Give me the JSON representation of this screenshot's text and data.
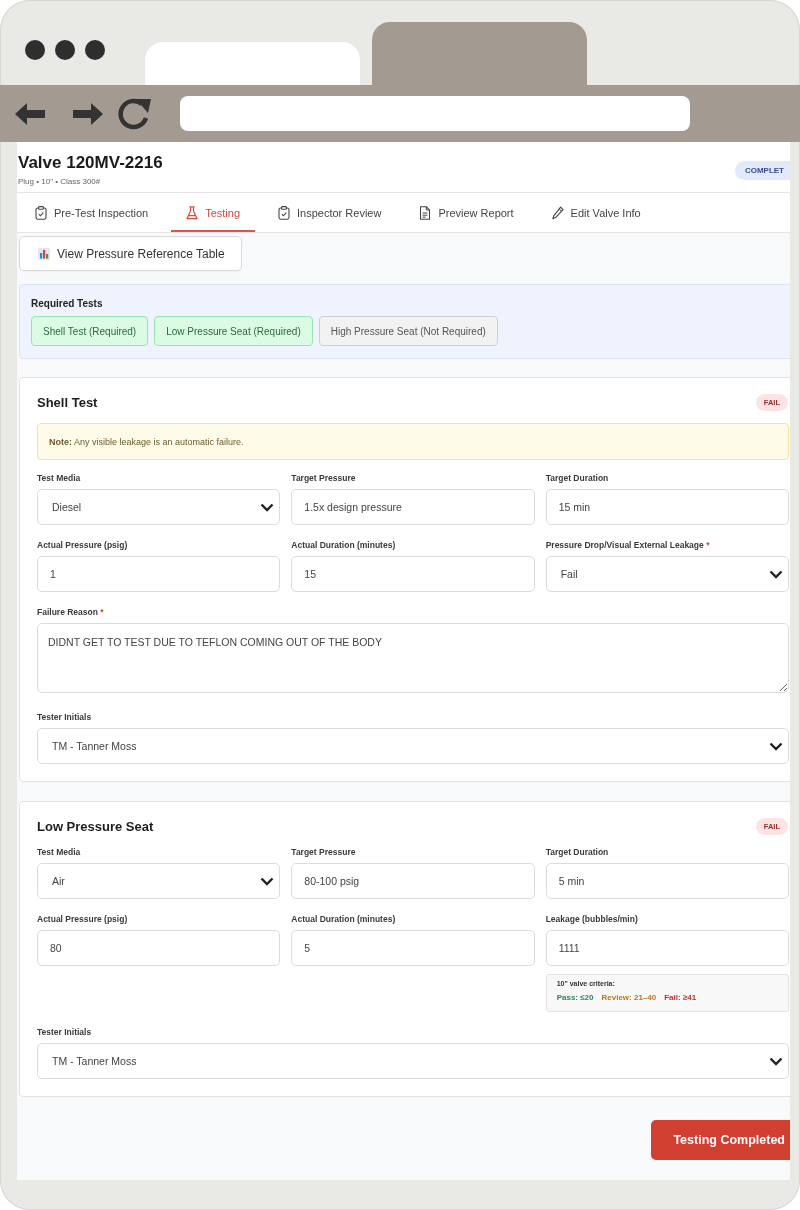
{
  "browser": {
    "tabs": [
      {
        "selected": true
      },
      {
        "selected": false
      }
    ]
  },
  "valve": {
    "title": "Valve 120MV-2216",
    "subtitle": "Plug • 10\" • Class 300#",
    "status": {
      "label": "COMPLET",
      "kind": "complete"
    }
  },
  "tabs": [
    {
      "label": "Pre-Test Inspection",
      "selected": false
    },
    {
      "label": "Testing",
      "selected": true
    },
    {
      "label": "Inspector Review",
      "selected": false
    },
    {
      "label": "Preview Report",
      "selected": false
    },
    {
      "label": "Edit Valve Info",
      "selected": false
    }
  ],
  "reference_button": {
    "label": "View Pressure Reference Table"
  },
  "required_tests": {
    "title": "Required Tests",
    "items": [
      {
        "label": "Shell Test (Required)",
        "required": true
      },
      {
        "label": "Low Pressure Seat (Required)",
        "required": true
      },
      {
        "label": "High Pressure Seat (Not Required)",
        "required": false
      }
    ]
  },
  "tests": [
    {
      "title": "Shell Test",
      "result": {
        "label": "FAIL",
        "kind": "fail"
      },
      "note": "**Note:** Any visible leakage is an automatic failure.",
      "rows": [
        [
          {
            "label": "Test Media",
            "kind": "select",
            "value": "Diesel"
          },
          {
            "label": "Target Pressure",
            "kind": "text",
            "value": "1.5x design pressure"
          },
          {
            "label": "Target Duration",
            "kind": "text",
            "value": "15 min"
          }
        ],
        [
          {
            "label": "Actual Pressure (psig)",
            "kind": "text",
            "value": "1"
          },
          {
            "label": "Actual Duration (minutes)",
            "kind": "text",
            "value": "15"
          },
          {
            "label": "Pressure Drop/Visual External Leakage",
            "required_mark": "*",
            "kind": "select",
            "value": "Fail"
          }
        ],
        [
          {
            "label": "Failure Reason",
            "required_mark": "*",
            "kind": "textarea",
            "value": "DIDNT GET TO TEST DUE TO TEFLON COMING OUT OF THE BODY"
          }
        ],
        [
          {
            "label": "Tester Initials",
            "kind": "select",
            "value": "TM - Tanner Moss"
          }
        ]
      ]
    },
    {
      "title": "Low Pressure Seat",
      "result": {
        "label": "FAIL",
        "kind": "fail"
      },
      "rows": [
        [
          {
            "label": "Test Media",
            "kind": "select",
            "value": "Air"
          },
          {
            "label": "Target Pressure",
            "kind": "text",
            "value": "80-100 psig"
          },
          {
            "label": "Target Duration",
            "kind": "text",
            "value": "5 min"
          }
        ],
        [
          {
            "label": "Actual Pressure (psig)",
            "kind": "text",
            "value": "80"
          },
          {
            "label": "Actual Duration (minutes)",
            "kind": "text",
            "value": "5"
          },
          {
            "label": "Leakage (bubbles/min)",
            "kind": "text",
            "value": "1111",
            "criteria": {
              "title": "10\" valve criteria:",
              "ranges": [
                {
                  "label": "Pass: ≤20",
                  "color": "#2f855a"
                },
                {
                  "label": "Review: 21–40",
                  "color": "#b7791f"
                },
                {
                  "label": "Fail: ≥41",
                  "color": "#c53030"
                }
              ]
            }
          }
        ],
        [
          {
            "label": "Tester Initials",
            "kind": "select",
            "value": "TM - Tanner Moss"
          }
        ]
      ]
    }
  ],
  "submit_button": {
    "label": "Testing Completed"
  }
}
